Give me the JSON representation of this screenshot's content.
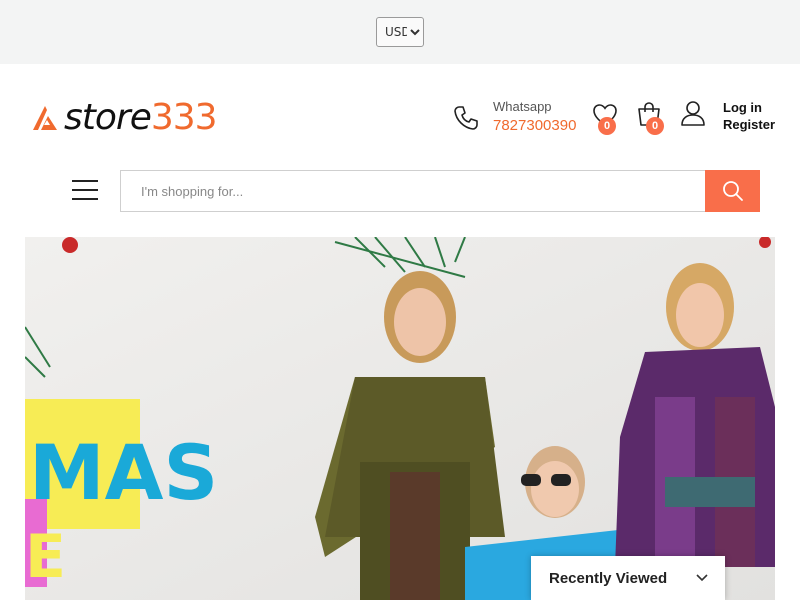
{
  "topbar": {
    "currency": {
      "selected": "USD",
      "options": [
        "USD"
      ]
    }
  },
  "header": {
    "logo": {
      "word": "store",
      "number": "333"
    },
    "contact": {
      "label": "Whatsapp",
      "number": "7827300390"
    },
    "wishlist_count": "0",
    "cart_count": "0",
    "account": {
      "login": "Log in",
      "register": "Register"
    }
  },
  "search": {
    "placeholder": "I'm shopping for..."
  },
  "banner": {
    "text_left": "MAS",
    "text_left_lower": "E"
  },
  "recently_viewed": {
    "label": "Recently Viewed"
  },
  "colors": {
    "accent": "#f96e4a",
    "brand_orange": "#f06a2e",
    "topbar_bg": "#f3f4f4"
  },
  "icons": [
    "phone-icon",
    "heart-icon",
    "cart-icon",
    "user-icon",
    "menu-icon",
    "search-icon",
    "chevron-down-icon"
  ]
}
